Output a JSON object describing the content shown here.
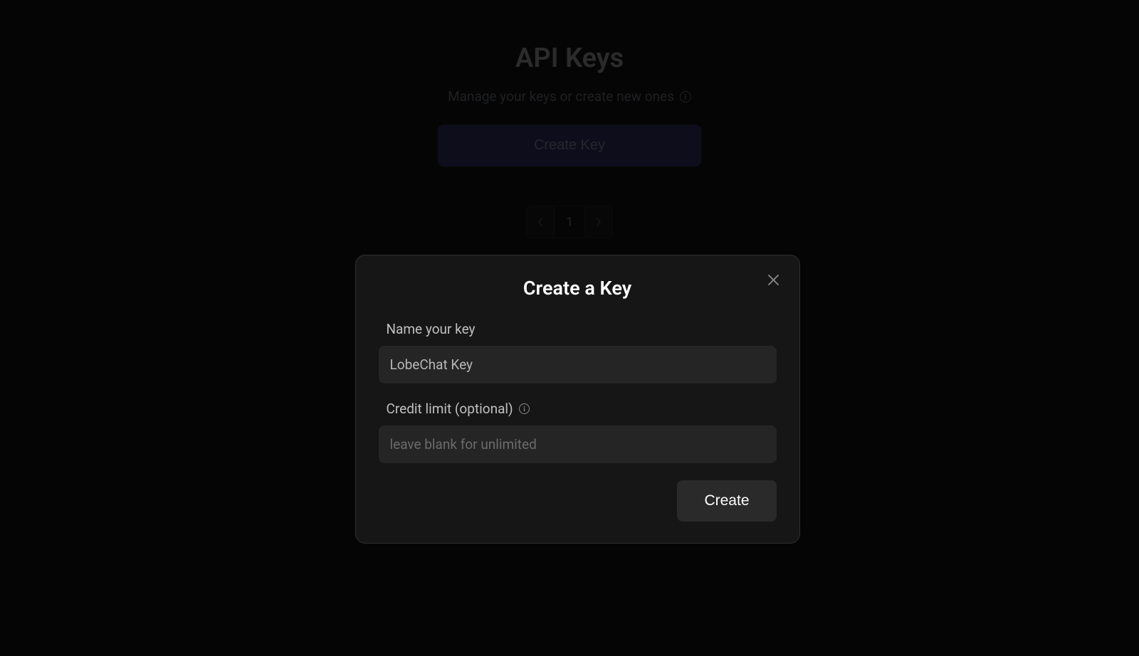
{
  "page": {
    "title": "API Keys",
    "subtitle": "Manage your keys or create new ones",
    "create_key_label": "Create Key"
  },
  "pagination": {
    "current": "1"
  },
  "modal": {
    "title": "Create a Key",
    "name_label": "Name your key",
    "name_value": "LobeChat Key",
    "credit_label": "Credit limit (optional)",
    "credit_placeholder": "leave blank for unlimited",
    "credit_value": "",
    "create_label": "Create"
  }
}
